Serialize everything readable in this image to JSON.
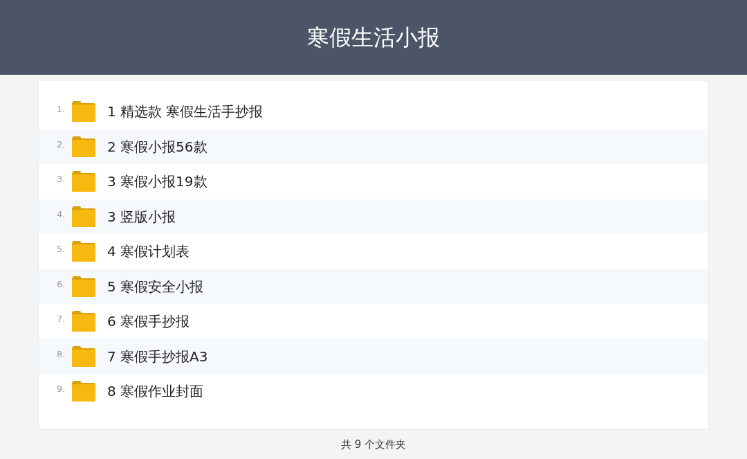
{
  "header": {
    "title": "寒假生活小报"
  },
  "folders": [
    {
      "index": "1.",
      "name": "1 精选款 寒假生活手抄报"
    },
    {
      "index": "2.",
      "name": "2 寒假小报56款"
    },
    {
      "index": "3.",
      "name": "3 寒假小报19款"
    },
    {
      "index": "4.",
      "name": "3 竖版小报"
    },
    {
      "index": "5.",
      "name": "4 寒假计划表"
    },
    {
      "index": "6.",
      "name": "5 寒假安全小报"
    },
    {
      "index": "7.",
      "name": "6 寒假手抄报"
    },
    {
      "index": "8.",
      "name": "7 寒假手抄报A3"
    },
    {
      "index": "9.",
      "name": "8 寒假作业封面"
    }
  ],
  "footer": {
    "summary": "共 9 个文件夹"
  }
}
